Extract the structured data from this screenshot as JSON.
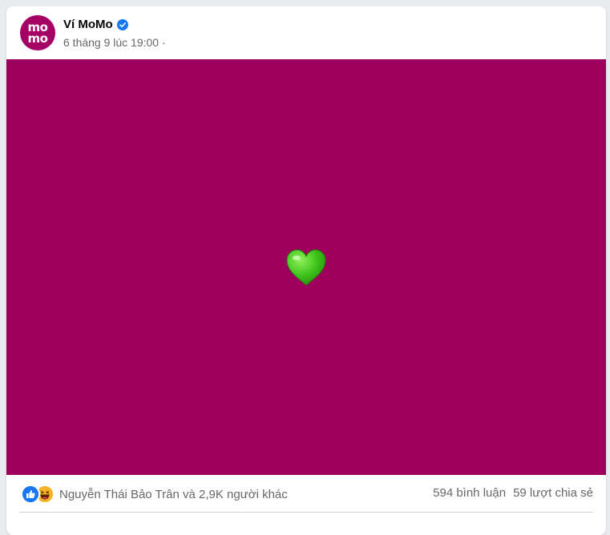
{
  "post": {
    "page_name": "Ví MoMo",
    "avatar_text_top": "mo",
    "avatar_text_bottom": "mo",
    "timestamp": "6 tháng 9 lúc 19:00",
    "separator": "·",
    "media_background": "#9e005d",
    "media_content_icon": "green-heart-icon"
  },
  "footer": {
    "reaction_icons": [
      "like-icon",
      "haha-icon"
    ],
    "reaction_text": "Nguyễn Thái Bảo Trân và 2,9K người khác",
    "comments": "594 bình luận",
    "shares": "59 lượt chia sẻ"
  },
  "colors": {
    "brand": "#a50064",
    "verified": "#1877f2",
    "heart": "#3fc21a"
  }
}
